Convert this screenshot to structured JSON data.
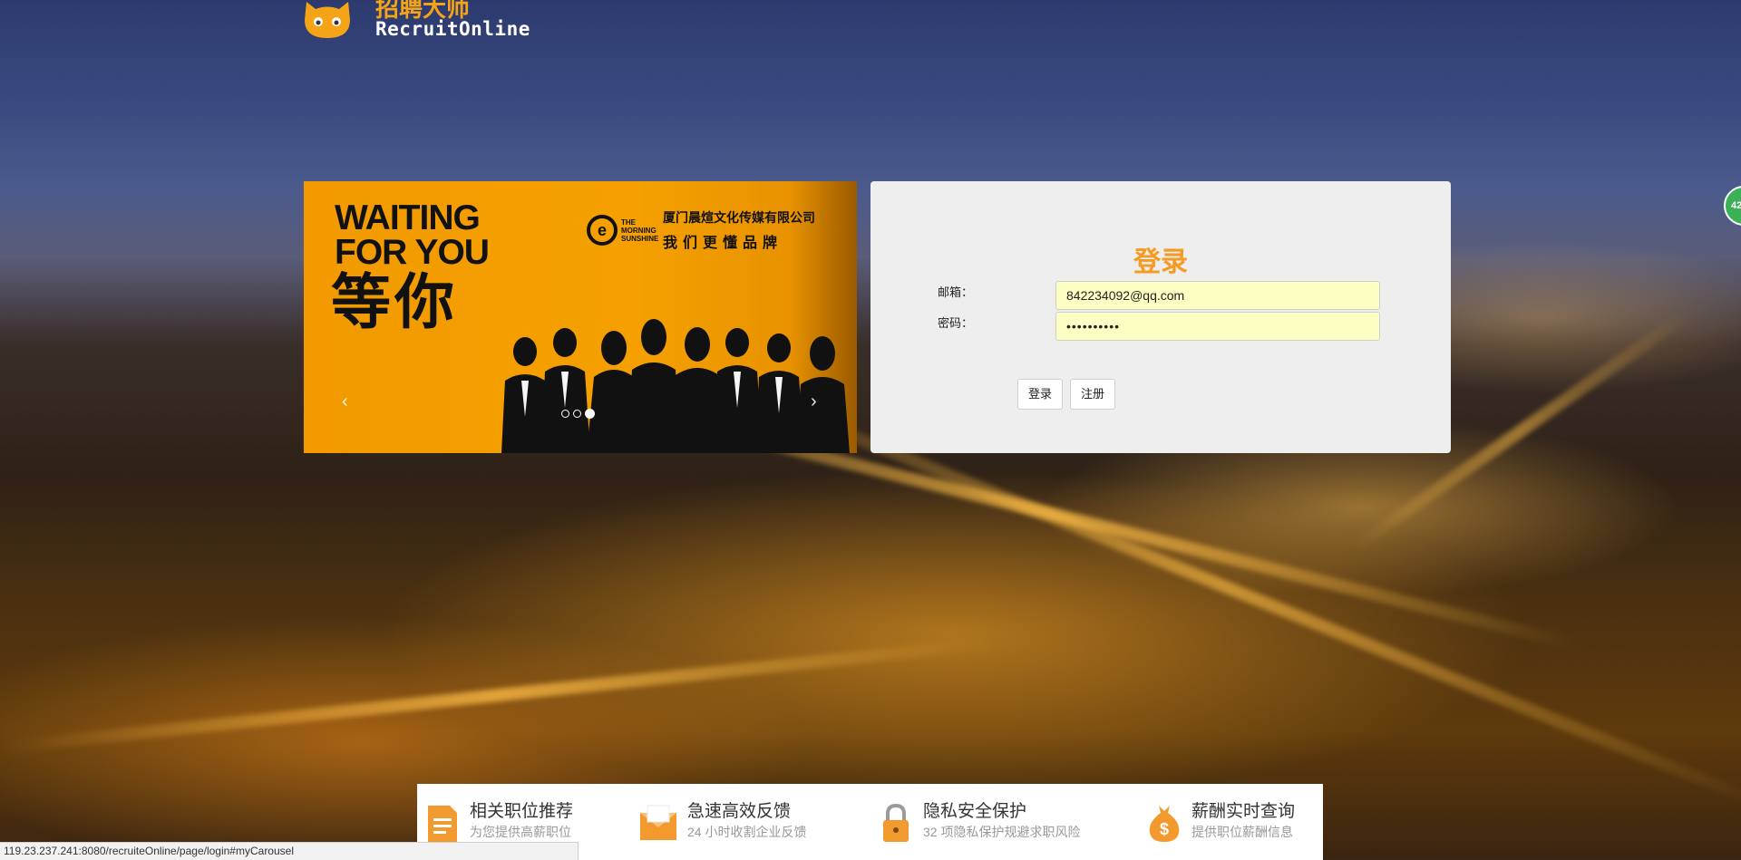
{
  "header": {
    "logo_cn": "招聘大师",
    "logo_en": "RecruitOnline"
  },
  "carousel": {
    "headline_en": "WAITING FOR YOU",
    "headline_cn": "等你",
    "brand_en": "THE MORNING SUNSHINE",
    "brand_cn_company": "厦门晨煊文化传媒有限公司",
    "brand_cn_slogan": "我们更懂品牌",
    "prev_label": "‹",
    "next_label": "›",
    "slide_count": 3,
    "active_slide": 3,
    "accent_color": "#f59a00"
  },
  "login": {
    "title": "登录",
    "email_label": "邮箱：",
    "email_value": "842234092@qq.com",
    "password_label": "密码：",
    "password_value": "••••••••••",
    "login_button": "登录",
    "register_button": "注册",
    "title_color": "#f59a23",
    "input_bg_color": "#fdffc2"
  },
  "side_badge": {
    "text": "42"
  },
  "features": [
    {
      "icon": "document-icon",
      "title": "相关职位推荐",
      "subtitle": "为您提供高薪职位"
    },
    {
      "icon": "mail-icon",
      "title": "急速高效反馈",
      "subtitle": "24 小时收割企业反馈"
    },
    {
      "icon": "lock-icon",
      "title": "隐私安全保护",
      "subtitle": "32 项隐私保护规避求职风险"
    },
    {
      "icon": "money-bag-icon",
      "title": "薪酬实时查询",
      "subtitle": "提供职位薪酬信息"
    }
  ],
  "statusbar": {
    "url": "119.23.237.241:8080/recruiteOnline/page/login#myCarousel"
  }
}
